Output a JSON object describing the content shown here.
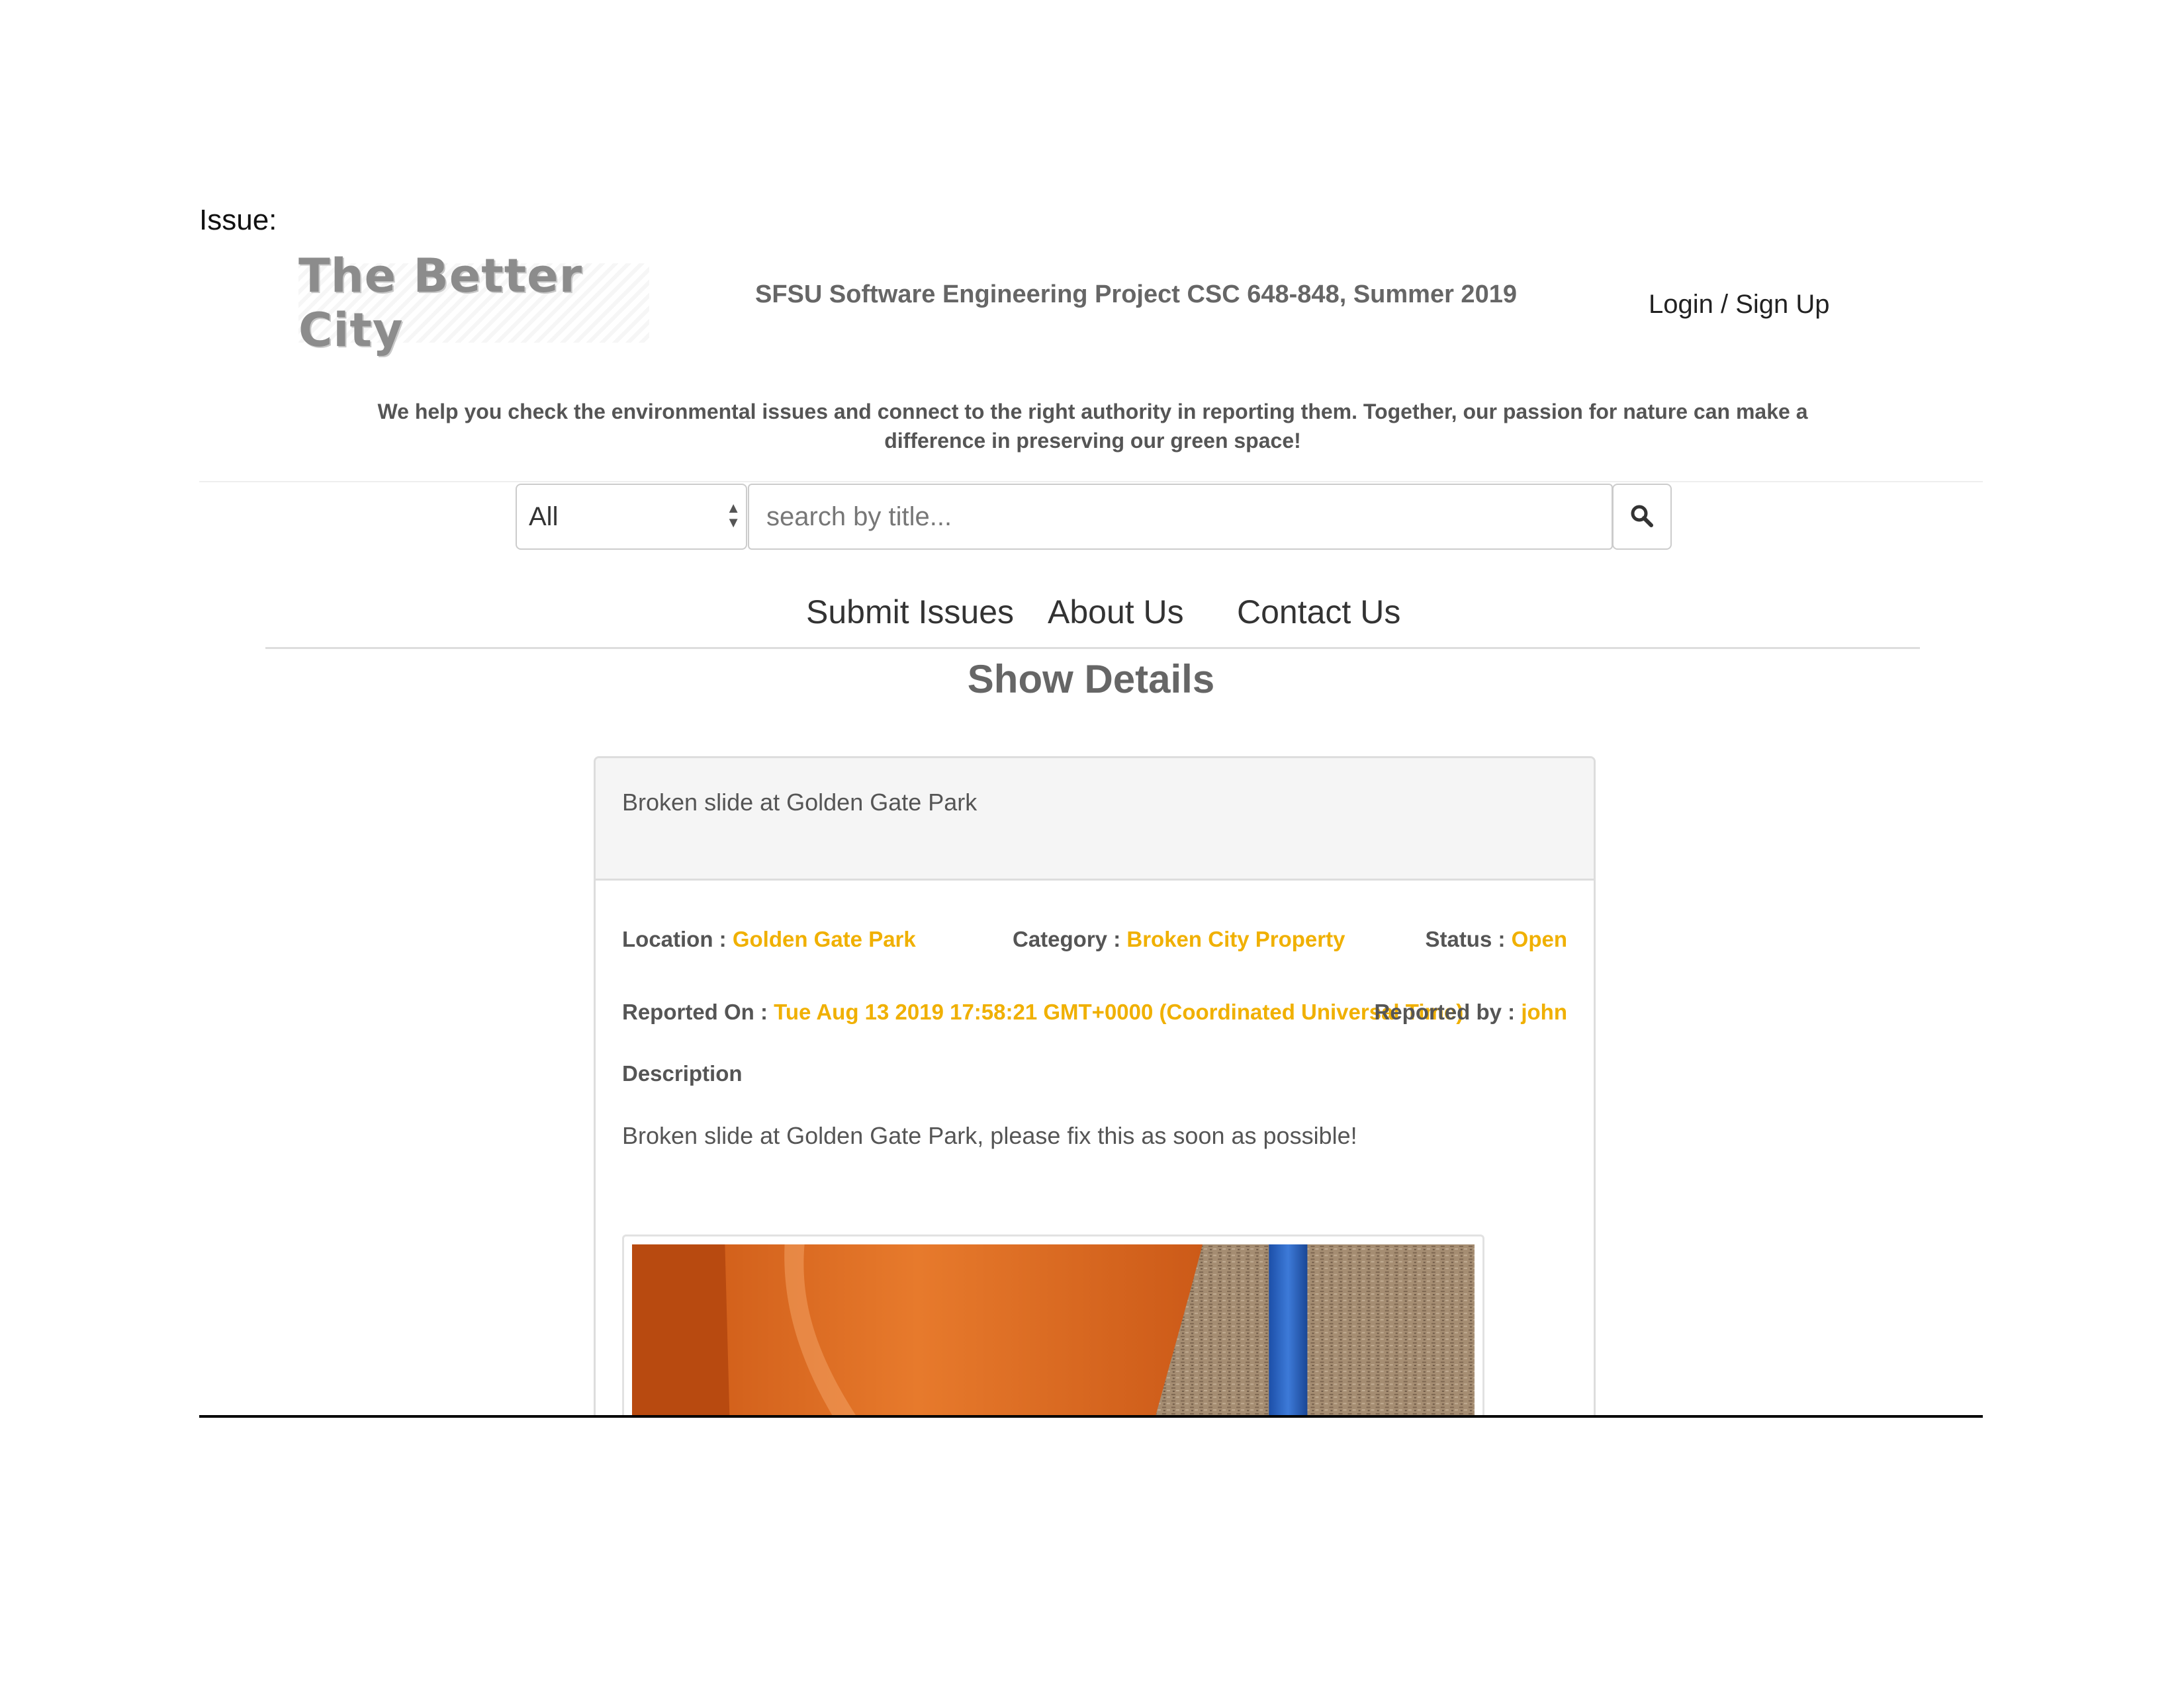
{
  "document": {
    "label": "Issue:"
  },
  "header": {
    "logo_text": "The Better City",
    "project_title": "SFSU Software Engineering Project CSC 648-848, Summer 2019",
    "login_label": "Login / Sign Up",
    "tagline": "We help you check the environmental issues and connect to the right authority in reporting them. Together, our passion for nature can make a difference in preserving our green space!"
  },
  "search": {
    "category_value": "All",
    "placeholder": "search by title...",
    "button_icon": "search-icon"
  },
  "nav": {
    "items": [
      {
        "label": "Submit Issues"
      },
      {
        "label": "About Us"
      },
      {
        "label": "Contact Us"
      }
    ]
  },
  "page_title": "Show Details",
  "issue": {
    "title": "Broken slide at Golden Gate Park",
    "location_label": "Location :",
    "location": "Golden Gate Park",
    "category_label": "Category :",
    "category": "Broken City Property",
    "status_label": "Status :",
    "status": "Open",
    "reported_on_label": "Reported On :",
    "reported_on": "Tue Aug 13 2019 17:58:21 GMT+0000 (Coordinated Universal Time)",
    "reported_by_label": "Reported by :",
    "reported_by": "john",
    "description_label": "Description",
    "description": "Broken slide at Golden Gate Park, please fix this as soon as possible!"
  },
  "colors": {
    "accent": "#f0b000",
    "label_text": "#555555",
    "panel_heading_bg": "#f5f5f5",
    "border": "#dddddd"
  }
}
